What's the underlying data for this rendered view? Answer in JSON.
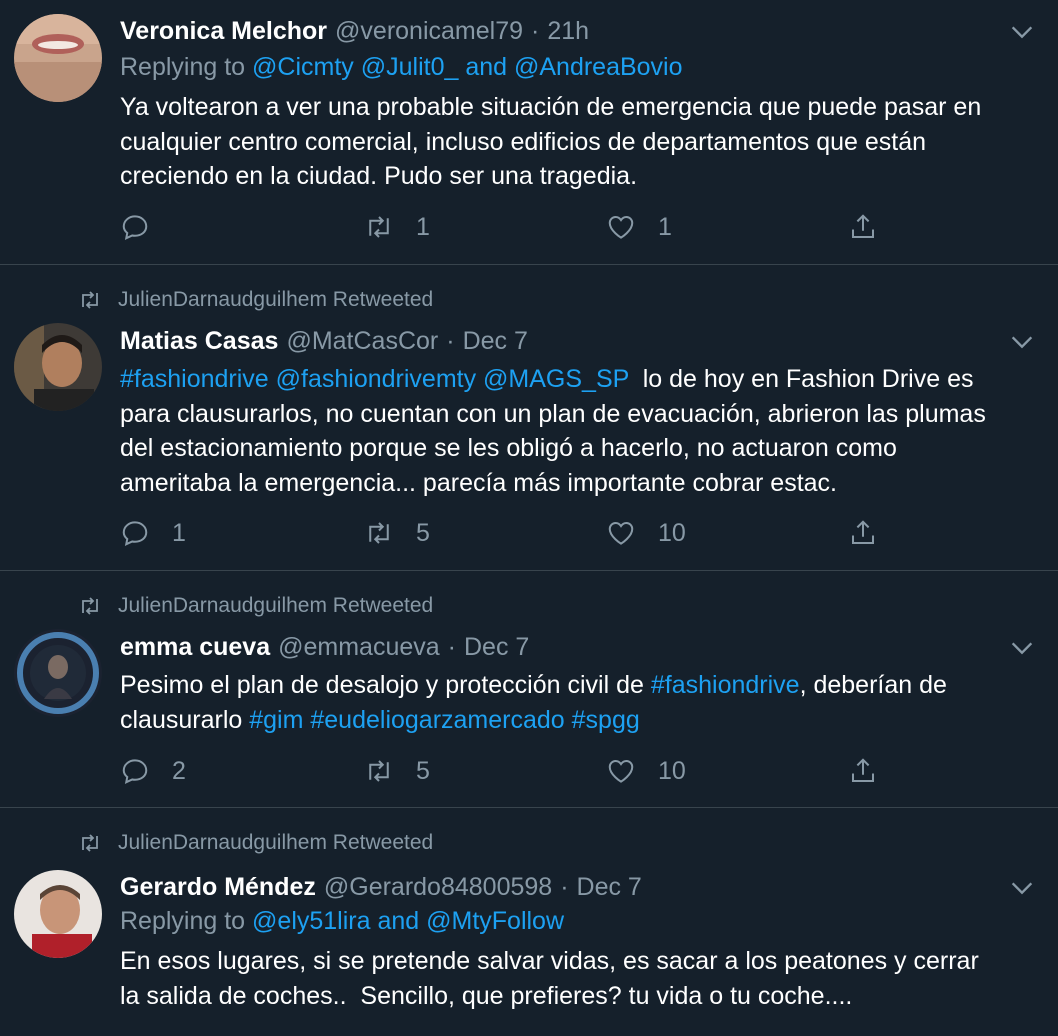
{
  "colors": {
    "background": "#15202b",
    "divider": "#38444d",
    "muted_text": "#8899a6",
    "link": "#1da1f2",
    "primary_text": "#ffffff"
  },
  "icons": {
    "reply": "speech-bubble",
    "retweet": "retweet-arrows",
    "like": "heart-outline",
    "share": "upload-arrow",
    "menu": "chevron-down"
  },
  "tweets": [
    {
      "name": "Veronica Melchor",
      "handle": "@veronicamel79",
      "dot": "·",
      "time": "21h",
      "replying_prefix": "Replying to",
      "replying_links": "@Cicmty @Julit0_ and @AndreaBovio",
      "body_lines": [
        "Ya voltearon a ver una probable situación de emergencia que puede pasar en",
        "cualquier centro comercial, incluso edificios de departamentos que están",
        "creciendo en la ciudad. Pudo ser una tragedia."
      ],
      "replies": "",
      "retweets": "1",
      "likes": "1"
    },
    {
      "retweeted_by": "JulienDarnaudguilhem Retweeted",
      "name": "Matias Casas",
      "handle": "@MatCasCor",
      "dot": "·",
      "time": "Dec 7",
      "body_line1_links": "#fashiondrive @fashiondrivemty @MAGS_SP",
      "body_line1_text": "  lo de hoy en Fashion Drive es",
      "body_lines": [
        "para clausurarlos, no cuentan con un plan de evacuación, abrieron las plumas",
        "del estacionamiento porque se les obligó a hacerlo, no actuaron como",
        "ameritaba la emergencia... parecía más importante cobrar estac."
      ],
      "replies": "1",
      "retweets": "5",
      "likes": "10"
    },
    {
      "retweeted_by": "JulienDarnaudguilhem Retweeted",
      "name": "emma cueva",
      "handle": "@emmacueva",
      "dot": "·",
      "time": "Dec 7",
      "body_line1_text": "Pesimo el plan de desalojo y protección civil de ",
      "body_line1_link": "#fashiondrive",
      "body_line1_tail": ", deberían de",
      "body_line2_text": "clausurarlo ",
      "body_line2_links": "#gim #eudeliogarzamercado #spgg",
      "replies": "2",
      "retweets": "5",
      "likes": "10"
    },
    {
      "retweeted_by": "JulienDarnaudguilhem Retweeted",
      "name": "Gerardo Méndez",
      "handle": "@Gerardo84800598",
      "dot": "·",
      "time": "Dec 7",
      "replying_prefix": "Replying to",
      "replying_links": "@ely51lira and @MtyFollow",
      "body_lines": [
        "En esos lugares, si se pretende salvar vidas, es sacar a los peatones y cerrar",
        "la salida de coches..  Sencillo, que prefieres? tu vida o tu coche...."
      ]
    }
  ]
}
